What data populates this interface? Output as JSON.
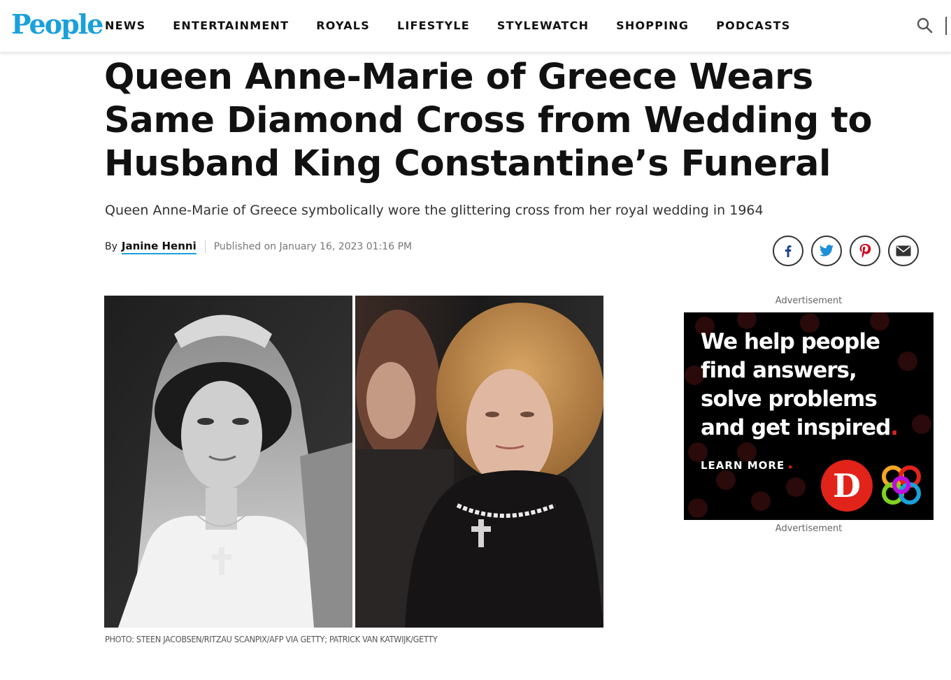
{
  "header": {
    "logo": "People",
    "nav": [
      "NEWS",
      "ENTERTAINMENT",
      "ROYALS",
      "LIFESTYLE",
      "STYLEWATCH",
      "SHOPPING",
      "PODCASTS"
    ],
    "search_icon": "search-icon"
  },
  "article": {
    "headline": "Queen Anne-Marie of Greece Wears Same Diamond Cross from Wedding to Husband King Constantine’s Funeral",
    "subhead": "Queen Anne-Marie of Greece symbolically wore the glittering cross from her royal wedding in 1964",
    "by_prefix": "By",
    "author": "Janine Henni",
    "published": "Published on January 16, 2023 01:16 PM",
    "share": [
      "facebook-icon",
      "twitter-icon",
      "pinterest-icon",
      "email-icon"
    ],
    "photo_credit": "PHOTO: STEEN JACOBSEN/RITZAU SCANPIX/AFP VIA GETTY; PATRICK VAN KATWIJK/GETTY"
  },
  "ad": {
    "label_top": "Advertisement",
    "label_bottom": "Advertisement",
    "text_lines": [
      "We help people",
      "find answers,",
      "solve problems",
      "and get inspired"
    ],
    "text_end": ".",
    "cta": "LEARN MORE",
    "cta_arrow": "▸",
    "badge": "D"
  },
  "colors": {
    "brand": "#1aa0db",
    "ad_bg": "#000000",
    "ad_accent": "#e2231a"
  }
}
